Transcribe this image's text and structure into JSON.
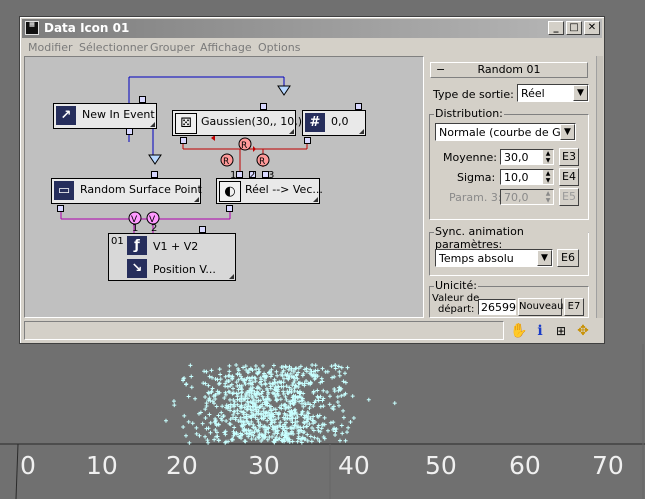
{
  "window": {
    "title": "Data Icon 01",
    "menu": [
      "Modifier",
      "Sélectionner",
      "Grouper",
      "Affichage",
      "Options"
    ]
  },
  "nodes": {
    "new_in_event": "New In Event",
    "gaussien": "Gaussien(30,, 10,)",
    "scalar": "0,0",
    "random_surface": "Random Surface Point",
    "reel_vec": "Réel --> Vec...",
    "expr_id": "01",
    "expr_formula": "V1 + V2",
    "expr_output": "Position V...",
    "converter_label": "R",
    "vector_label": "V",
    "port_numbers": [
      "1",
      "2",
      "3"
    ]
  },
  "panel": {
    "rollout_title": "Random 01",
    "output_type_label": "Type de sortie:",
    "output_type_value": "Réel",
    "distribution_label": "Distribution:",
    "distribution_value": "Normale (courbe de Gaus",
    "mean_label": "Moyenne:",
    "mean_value": "30,0",
    "sigma_label": "Sigma:",
    "sigma_value": "10,0",
    "param3_label": "Param. 3:",
    "param3_value": "70,0",
    "btn_e3": "E3",
    "btn_e4": "E4",
    "btn_e5": "E5",
    "sync_label": "Sync. animation paramètres:",
    "sync_value": "Temps absolu",
    "btn_e6": "E6",
    "unicity_label": "Unicité:",
    "start_value_label_1": "Valeur de",
    "start_value_label_2": "départ:",
    "seed_value": "26599",
    "new_btn": "Nouveau",
    "btn_e7": "E7"
  },
  "viewport": {
    "ticks": [
      "0",
      "10",
      "20",
      "30",
      "40",
      "50",
      "60",
      "70"
    ],
    "particle_color": "#c8ffff"
  },
  "icons": [
    "hand-icon",
    "info-icon",
    "grid-icon",
    "move-icon"
  ]
}
